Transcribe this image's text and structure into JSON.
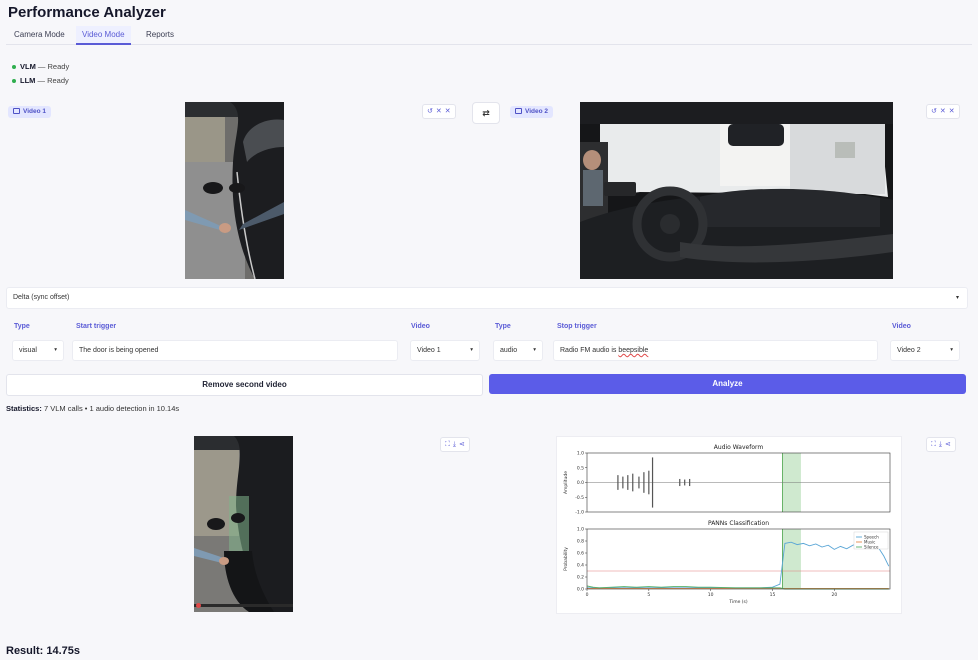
{
  "app": {
    "title": "Performance Analyzer"
  },
  "tabs": [
    {
      "label": "Camera Mode",
      "active": false
    },
    {
      "label": "Video Mode",
      "active": true
    },
    {
      "label": "Reports",
      "active": false
    }
  ],
  "status": [
    {
      "name": "VLM",
      "sep": " — ",
      "state": "Ready"
    },
    {
      "name": "LLM",
      "sep": " — ",
      "state": "Ready"
    }
  ],
  "videos": {
    "video1": {
      "label": "Video 1"
    },
    "video2": {
      "label": "Video 2"
    },
    "swap_icon": "swap-arrows-icon"
  },
  "delta": {
    "label": "Delta (sync offset)"
  },
  "start": {
    "type_label": "Type",
    "type_value": "visual",
    "trigger_label": "Start trigger",
    "trigger_value": "The door is being opened",
    "video_label": "Video",
    "video_value": "Video 1"
  },
  "stop": {
    "type_label": "Type",
    "type_value": "audio",
    "trigger_label": "Stop trigger",
    "trigger_prefix": "Radio FM audio is ",
    "trigger_misspelled": "beepsible",
    "video_label": "Video",
    "video_value": "Video 2"
  },
  "actions": {
    "remove_label": "Remove second video",
    "analyze_label": "Analyze"
  },
  "stats": {
    "label": "Statistics:",
    "text": " 7 VLM calls • 1 audio detection in 10.14s"
  },
  "chart_data": [
    {
      "type": "line",
      "title": "Audio Waveform",
      "xlabel": "",
      "ylabel": "Amplitude",
      "xlim": [
        0,
        24.5
      ],
      "ylim": [
        -1.0,
        1.0
      ],
      "yticks": [
        -1.0,
        -0.5,
        0.0,
        0.5,
        1.0
      ],
      "highlight": [
        15.8,
        17.3
      ],
      "bursts": [
        {
          "x": 2.5,
          "amp": 0.25
        },
        {
          "x": 2.9,
          "amp": 0.2
        },
        {
          "x": 3.3,
          "amp": 0.25
        },
        {
          "x": 3.7,
          "amp": 0.3
        },
        {
          "x": 4.2,
          "amp": 0.2
        },
        {
          "x": 4.6,
          "amp": 0.35
        },
        {
          "x": 5.0,
          "amp": 0.4
        },
        {
          "x": 5.3,
          "amp": 0.85
        },
        {
          "x": 7.5,
          "amp": 0.12
        },
        {
          "x": 7.9,
          "amp": 0.1
        },
        {
          "x": 8.3,
          "amp": 0.12
        }
      ],
      "grid": false
    },
    {
      "type": "line",
      "title": "PANNs Classification",
      "xlabel": "Time (s)",
      "ylabel": "Probability",
      "xlim": [
        0,
        24.5
      ],
      "ylim": [
        0,
        1.0
      ],
      "xticks": [
        0,
        5,
        10,
        15,
        20
      ],
      "yticks": [
        0.0,
        0.2,
        0.4,
        0.6,
        0.8,
        1.0
      ],
      "threshold": 0.3,
      "highlight": [
        15.8,
        17.3
      ],
      "legend_position": "top-right",
      "series": [
        {
          "name": "Speech",
          "color": "#5aa6d6",
          "x": [
            0,
            1,
            2,
            3,
            4,
            5,
            6,
            7,
            8,
            9,
            10,
            11,
            12,
            13,
            14,
            15,
            15.6,
            16.0,
            16.5,
            17,
            17.5,
            18,
            18.5,
            19,
            19.5,
            20,
            20.5,
            21,
            21.5,
            22,
            22.5,
            23,
            23.5,
            24,
            24.4
          ],
          "y": [
            0.02,
            0.02,
            0.02,
            0.02,
            0.02,
            0.02,
            0.02,
            0.02,
            0.02,
            0.02,
            0.02,
            0.02,
            0.02,
            0.02,
            0.02,
            0.03,
            0.08,
            0.76,
            0.78,
            0.74,
            0.76,
            0.72,
            0.75,
            0.7,
            0.73,
            0.66,
            0.71,
            0.67,
            0.73,
            0.76,
            0.78,
            0.74,
            0.71,
            0.55,
            0.38
          ]
        },
        {
          "name": "Music",
          "color": "#e58b4b",
          "x": [
            0,
            5,
            10,
            15,
            24.4
          ],
          "y": [
            0.01,
            0.01,
            0.01,
            0.01,
            0.01
          ]
        },
        {
          "name": "Silence",
          "color": "#59b06a",
          "x": [
            0,
            0.5,
            1,
            2,
            3,
            4,
            5,
            6,
            7,
            8,
            9,
            10,
            12,
            14,
            15,
            15.6,
            16,
            24.4
          ],
          "y": [
            0.05,
            0.03,
            0.02,
            0.03,
            0.04,
            0.03,
            0.04,
            0.03,
            0.04,
            0.04,
            0.03,
            0.03,
            0.02,
            0.02,
            0.02,
            0.02,
            0.0,
            0.0
          ]
        }
      ]
    }
  ]
}
